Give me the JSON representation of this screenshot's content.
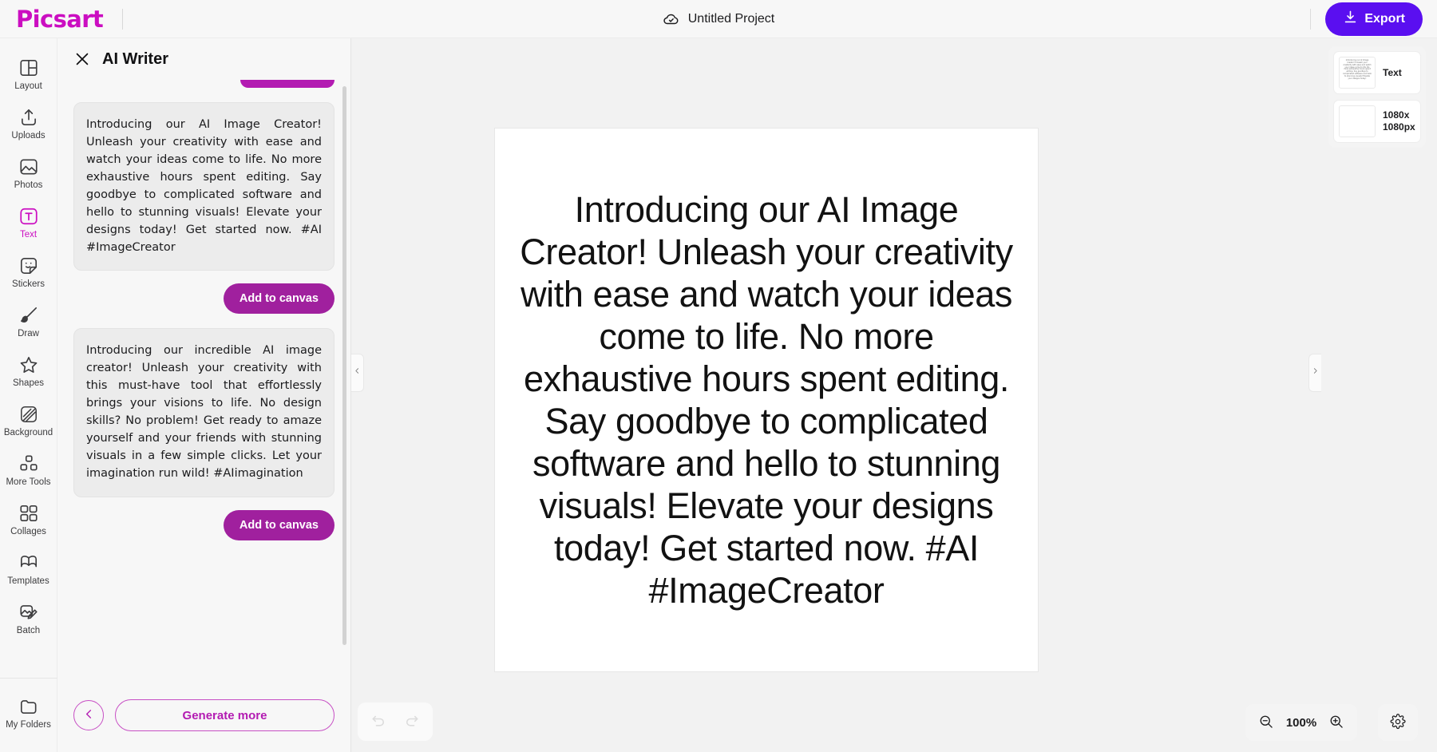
{
  "brand": {
    "name": "Picsart"
  },
  "header": {
    "project_title": "Untitled Project",
    "cloud_icon": "cloud-check-icon",
    "export_label": "Export",
    "export_icon": "download-icon",
    "export_color": "#5a0ff0"
  },
  "sidebar": {
    "items": [
      {
        "label": "Layout",
        "icon": "layout-icon",
        "active": false
      },
      {
        "label": "Uploads",
        "icon": "upload-icon",
        "active": false
      },
      {
        "label": "Photos",
        "icon": "photo-icon",
        "active": false
      },
      {
        "label": "Text",
        "icon": "text-icon",
        "active": true
      },
      {
        "label": "Stickers",
        "icon": "sticker-icon",
        "active": false
      },
      {
        "label": "Draw",
        "icon": "brush-icon",
        "active": false
      },
      {
        "label": "Shapes",
        "icon": "star-icon",
        "active": false
      },
      {
        "label": "Background",
        "icon": "background-icon",
        "active": false
      },
      {
        "label": "More Tools",
        "icon": "more-tools-icon",
        "active": false
      },
      {
        "label": "Collages",
        "icon": "collages-icon",
        "active": false
      },
      {
        "label": "Templates",
        "icon": "templates-icon",
        "active": false
      },
      {
        "label": "Batch",
        "icon": "batch-icon",
        "active": false
      }
    ],
    "bottom_item": {
      "label": "My Folders",
      "icon": "folder-icon"
    },
    "active_color": "#cb0ec1"
  },
  "panel": {
    "title": "AI Writer",
    "close_icon": "close-icon",
    "results": [
      {
        "text": "Introducing our AI Image Creator! Unleash your creativity with ease and watch your ideas come to life. No more exhaustive hours spent editing. Say goodbye to complicated software and hello to stunning visuals! Elevate your designs today! Get started now. #AI #ImageCreator",
        "add_label": "Add to canvas"
      },
      {
        "text": "Introducing our incredible AI image creator! Unleash your creativity with this must-have tool that effortlessly brings your visions to life. No design skills? No problem! Get ready to amaze yourself and your friends with stunning visuals in a few simple clicks. Let your imagination run wild! #AIimagination",
        "add_label": "Add to canvas"
      }
    ],
    "footer": {
      "back_icon": "chevron-left-icon",
      "generate_more_label": "Generate more"
    },
    "accent_color": "#b31bb2",
    "button_color": "#a0209e"
  },
  "canvas": {
    "text": "Introducing our AI Image Creator! Unleash your creativity with ease and watch your ideas come to life. No more exhaustive hours spent editing. Say goodbye to complicated software and hello to stunning visuals! Elevate your designs today! Get started now. #AI #ImageCreator"
  },
  "layers": {
    "items": [
      {
        "label": "Text",
        "thumb_text": "Introducing our AI Image Creator! Unleash your creativity with ease and watch your ideas come to life. No more exhaustive hours spent editing. Say goodbye to complicated software and hello to stunning visuals! Elevate your designs today!",
        "has_thumb_text": true
      },
      {
        "label": "1080x 1080px",
        "thumb_text": "",
        "has_thumb_text": false
      }
    ]
  },
  "bottom_bar": {
    "undo_icon": "undo-icon",
    "redo_icon": "redo-icon",
    "zoom_out_icon": "zoom-out-icon",
    "zoom_in_icon": "zoom-in-icon",
    "zoom_level": "100%",
    "settings_icon": "gear-icon"
  },
  "handles": {
    "left_icon": "chevron-left-icon",
    "right_icon": "chevron-right-icon"
  }
}
